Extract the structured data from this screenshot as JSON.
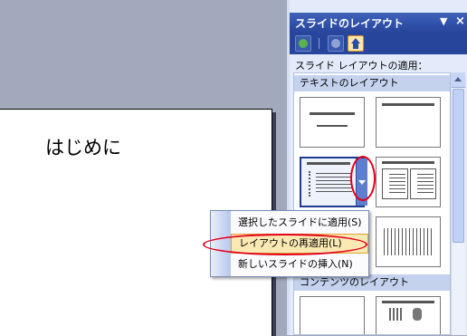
{
  "slide": {
    "title": "はじめに"
  },
  "pane": {
    "title": "スライドのレイアウト",
    "menu_arrow": "▼",
    "close_glyph": "×",
    "toolbar": {
      "back_icon": "back-icon",
      "forward_icon": "forward-icon",
      "home_icon": "home-icon"
    },
    "apply_label": "スライド レイアウトの適用：",
    "sections": [
      "テキストのレイアウト",
      "コンテンツのレイアウト"
    ]
  },
  "context_menu": {
    "items": [
      "選択したスライドに適用(S)",
      "レイアウトの再適用(L)",
      "新しいスライドの挿入(N)"
    ],
    "highlighted_index": 1
  },
  "colors": {
    "pane_header": "#27459b",
    "pane_bg": "#e3ebfa",
    "menu_highlight": "#fbe9b4",
    "annotation": "#e3001a",
    "workspace": "#a3a9bd"
  }
}
